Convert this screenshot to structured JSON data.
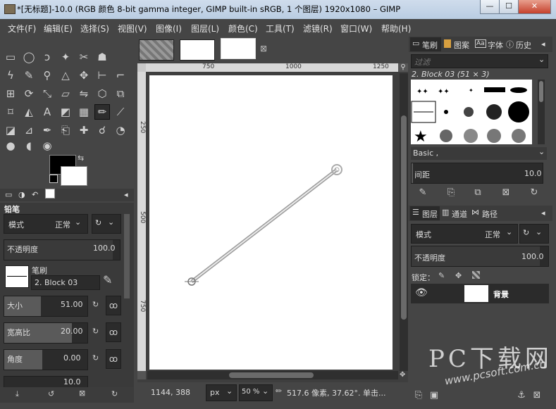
{
  "window": {
    "title": "*[无标题]-10.0 (RGB 颜色 8-bit gamma integer, GIMP built-in sRGB, 1 个图层) 1920x1080 – GIMP",
    "min": "—",
    "max": "☐",
    "close": "✕"
  },
  "menu": [
    "文件(F)",
    "编辑(E)",
    "选择(S)",
    "视图(V)",
    "图像(I)",
    "图层(L)",
    "颜色(C)",
    "工具(T)",
    "滤镜(R)",
    "窗口(W)",
    "帮助(H)"
  ],
  "tool_options": {
    "title": "铅笔",
    "mode_label": "模式",
    "mode_value": "正常",
    "opacity_label": "不透明度",
    "opacity_value": "100.0",
    "brush_label": "笔刷",
    "brush_name": "2. Block 03",
    "size_label": "大小",
    "size_value": "51.00",
    "aspect_label": "宽高比",
    "aspect_value": "20.00",
    "angle_label": "角度",
    "angle_value": "0.00",
    "spacing_value": "10.0"
  },
  "canvas": {
    "ruler_labels": [
      "750",
      "1000",
      "1250"
    ],
    "vruler_labels": [
      "250",
      "500",
      "750"
    ]
  },
  "status": {
    "coords": "1144, 388",
    "unit": "px",
    "zoom": "50 %",
    "message": "517.6 像素, 37.62°. 单击..."
  },
  "right_top": {
    "tabs": [
      "笔刷",
      "图案",
      "字体",
      "历史"
    ],
    "filter_placeholder": "过滤",
    "brush_title": "2. Block 03 (51 × 3)",
    "preset": "Basic ,",
    "spacing_label": "间距",
    "spacing_value": "10.0"
  },
  "right_bottom": {
    "tabs": [
      "图层",
      "通道",
      "路径"
    ],
    "mode_label": "模式",
    "mode_value": "正常",
    "opacity_label": "不透明度",
    "opacity_value": "100.0",
    "lock_label": "锁定：",
    "layer_name": "背景"
  },
  "watermark": {
    "brand": "PC下载网",
    "url": "www.pcsoft.com.cn"
  }
}
